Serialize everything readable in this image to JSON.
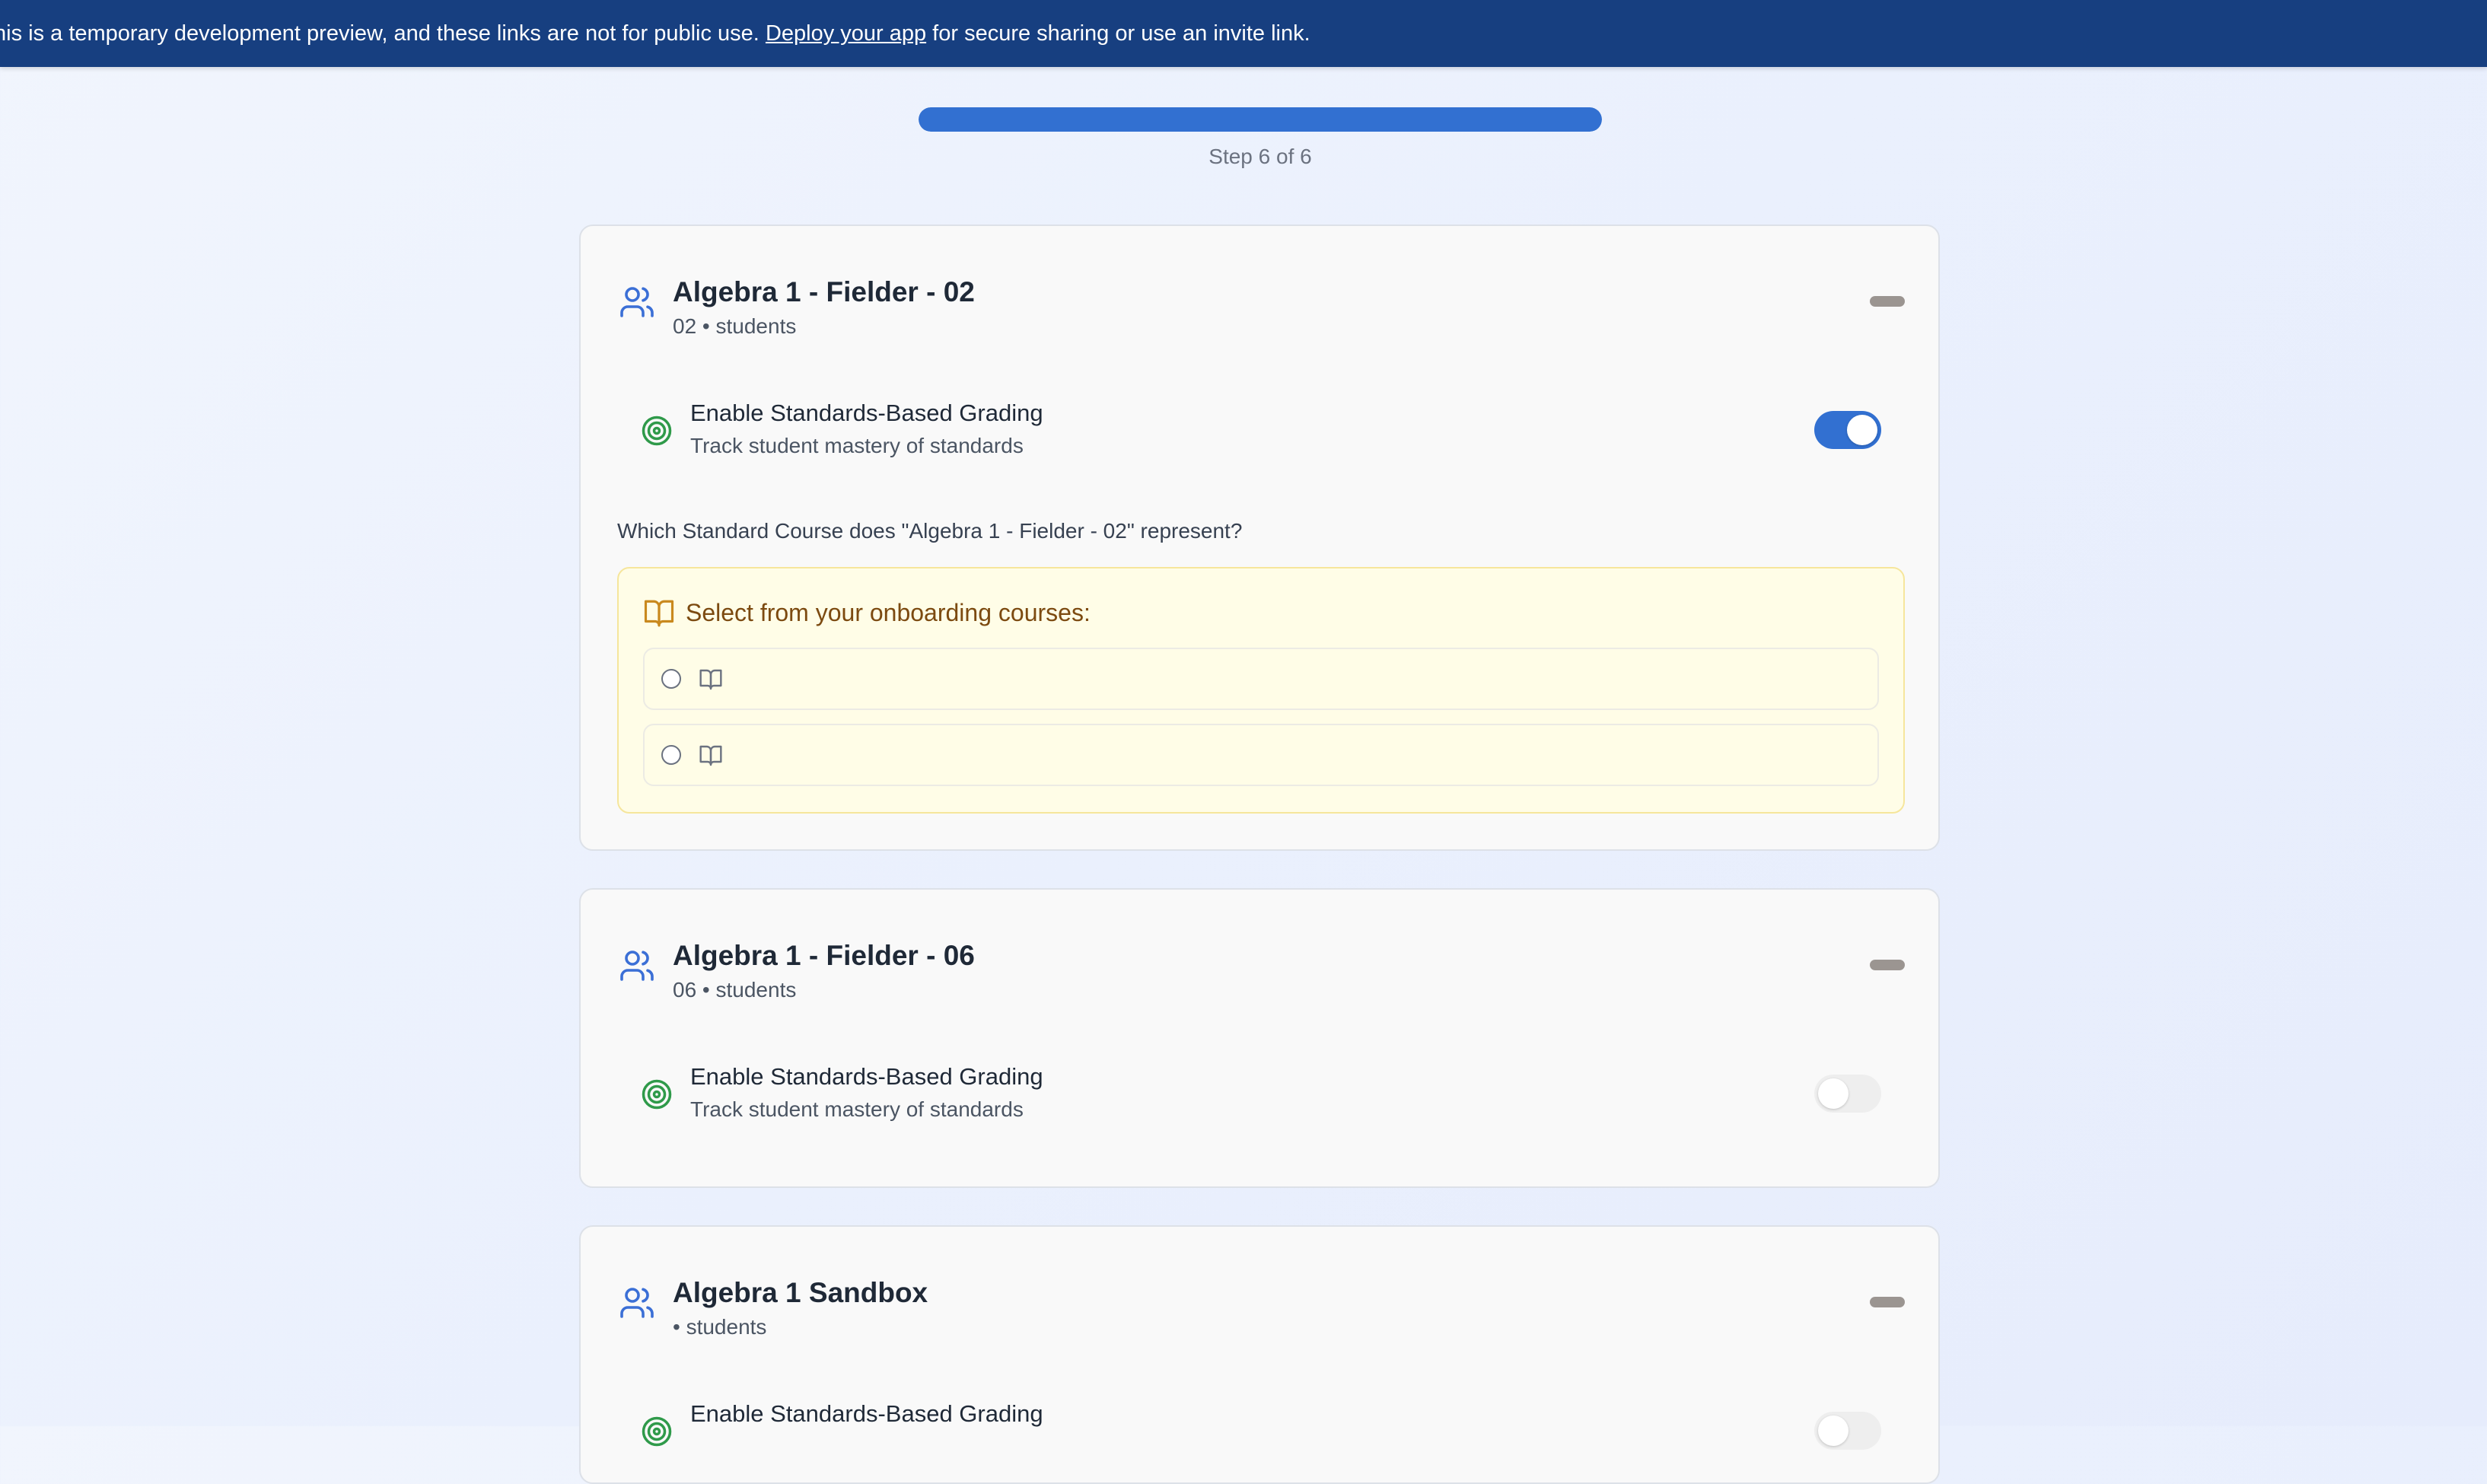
{
  "banner": {
    "text_before": "his is a temporary development preview, and these links are not for public use. ",
    "link_label": "Deploy your app",
    "text_after": " for secure sharing or use an invite link."
  },
  "progress": {
    "step_label": "Step 6 of 6",
    "value_percent": 100
  },
  "cards": [
    {
      "title": "Algebra 1 - Fielder - 02",
      "subtitle": "02 • students",
      "grading_title": "Enable Standards-Based Grading",
      "grading_subtitle": "Track student mastery of standards",
      "grading_enabled": true,
      "question": "Which Standard Course does \"Algebra 1 - Fielder - 02\" represent?",
      "select_title": "Select from your onboarding courses:",
      "options": [
        "",
        ""
      ]
    },
    {
      "title": "Algebra 1 - Fielder - 06",
      "subtitle": "06 • students",
      "grading_title": "Enable Standards-Based Grading",
      "grading_subtitle": "Track student mastery of standards",
      "grading_enabled": false
    },
    {
      "title": "Algebra 1 Sandbox",
      "subtitle": "• students",
      "grading_title": "Enable Standards-Based Grading",
      "grading_enabled": false
    }
  ],
  "colors": {
    "banner": "#173f80",
    "accent": "#3270d1",
    "users_icon": "#3b6fd6",
    "target_icon": "#2f9a4a",
    "book_icon": "#c9891e"
  },
  "icons": {
    "card_header": "users-icon",
    "grading": "target-icon",
    "courses": "book-open-icon"
  }
}
